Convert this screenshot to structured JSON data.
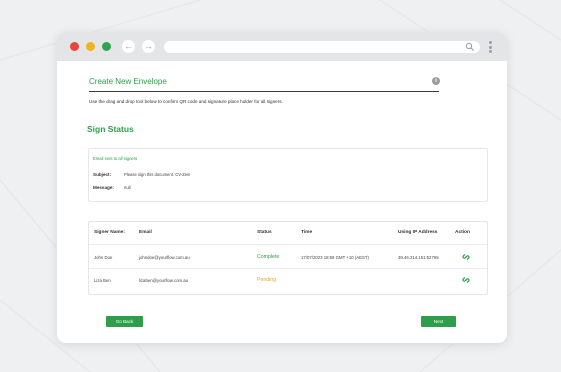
{
  "colors": {
    "brand_green": "#2f9e4a",
    "pending_orange": "#e8a22b",
    "chrome_gray": "#e3e5e6"
  },
  "browser": {
    "nav_back_icon": "arrow-left-icon",
    "nav_forward_icon": "arrow-right-icon",
    "search_icon": "search-icon",
    "back_glyph": "←",
    "forward_glyph": "→"
  },
  "page": {
    "title": "Create New Envelope",
    "info_glyph": "i",
    "instructions": "Use the drag and drop tool below to confirm QR code and signature place holder for all signers."
  },
  "sign_status": {
    "heading": "Sign Status",
    "email_sent": "Email sent to all signers",
    "subject_label": "Subject:",
    "subject_value": "Please sign this document. CV-Zein",
    "message_label": "Message:",
    "message_value": "null"
  },
  "table": {
    "headers": {
      "signer_name": "Signer Name:",
      "email": "Email",
      "status": "Status",
      "time": "Time",
      "ip": "Using IP Address",
      "action": "Action"
    },
    "rows": [
      {
        "name": "John Doe",
        "email": "johndoe@yourflow.com.au",
        "status": "Complete",
        "time": "17/07/2023 18:58 GMT +10 (AEST)",
        "ip": "39.46.214.151:52765"
      },
      {
        "name": "Liza Ben",
        "email": "lizaben@yourflow.com.au",
        "status": "Pending",
        "time": "",
        "ip": ""
      }
    ]
  },
  "buttons": {
    "back": "Go Back",
    "next": "Next"
  }
}
